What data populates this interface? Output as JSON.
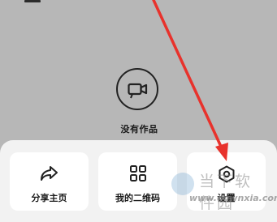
{
  "empty_state": {
    "text": "没有作品",
    "icon": "video-camera-icon"
  },
  "bottom_sheet": {
    "items": [
      {
        "label": "分享主页",
        "icon": "share-arrow-icon"
      },
      {
        "label": "我的二维码",
        "icon": "qr-code-icon"
      },
      {
        "label": "设置",
        "icon": "settings-gear-icon"
      }
    ]
  },
  "annotation": {
    "color": "#e8322c"
  },
  "watermark": {
    "title": "当下软件园",
    "url": "www.downxia.com"
  }
}
